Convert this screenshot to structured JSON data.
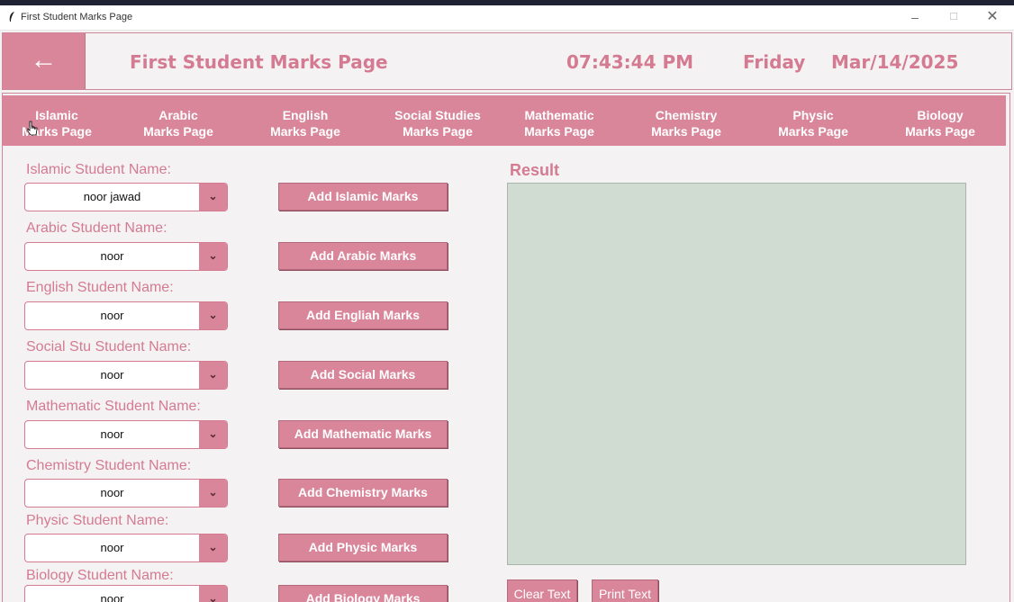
{
  "window": {
    "title": "First Student Marks Page",
    "controls": {
      "minimize": "–",
      "maximize": "☐",
      "close": "✕"
    }
  },
  "header": {
    "back_label": "←",
    "title": "First Student Marks Page",
    "time": "07:43:44 PM",
    "weekday": "Friday",
    "date": "Mar/14/2025"
  },
  "nav": [
    {
      "line1": "Islamic",
      "line2": "Marks Page"
    },
    {
      "line1": "Arabic",
      "line2": "Marks Page"
    },
    {
      "line1": "English",
      "line2": "Marks Page"
    },
    {
      "line1": "Social Studies",
      "line2": "Marks Page"
    },
    {
      "line1": "Mathematic",
      "line2": "Marks Page"
    },
    {
      "line1": "Chemistry",
      "line2": "Marks Page"
    },
    {
      "line1": "Physic",
      "line2": "Marks Page"
    },
    {
      "line1": "Biology",
      "line2": "Marks Page"
    }
  ],
  "subjects": [
    {
      "label": "Islamic Student Name:",
      "value": "noor jawad",
      "button": "Add Islamic Marks"
    },
    {
      "label": "Arabic Student Name:",
      "value": "noor",
      "button": "Add Arabic Marks"
    },
    {
      "label": "English Student Name:",
      "value": "noor",
      "button": "Add Engliah Marks"
    },
    {
      "label": "Social Stu Student Name:",
      "value": "noor",
      "button": "Add Social Marks"
    },
    {
      "label": "Mathematic Student Name:",
      "value": "noor",
      "button": "Add Mathematic Marks"
    },
    {
      "label": "Chemistry Student Name:",
      "value": "noor",
      "button": "Add Chemistry Marks"
    },
    {
      "label": "Physic Student Name:",
      "value": "noor",
      "button": "Add Physic Marks"
    },
    {
      "label": "Biology Student Name:",
      "value": "noor",
      "button": "Add Biology Marks"
    }
  ],
  "dropdown_arrow": "⌄",
  "result": {
    "label": "Result",
    "text": "",
    "clear_label": "Clear Text",
    "print_label": "Print Text"
  },
  "colors": {
    "accent": "#d9869b",
    "accent_text": "#d47b92",
    "result_bg": "#d0dcd2"
  }
}
